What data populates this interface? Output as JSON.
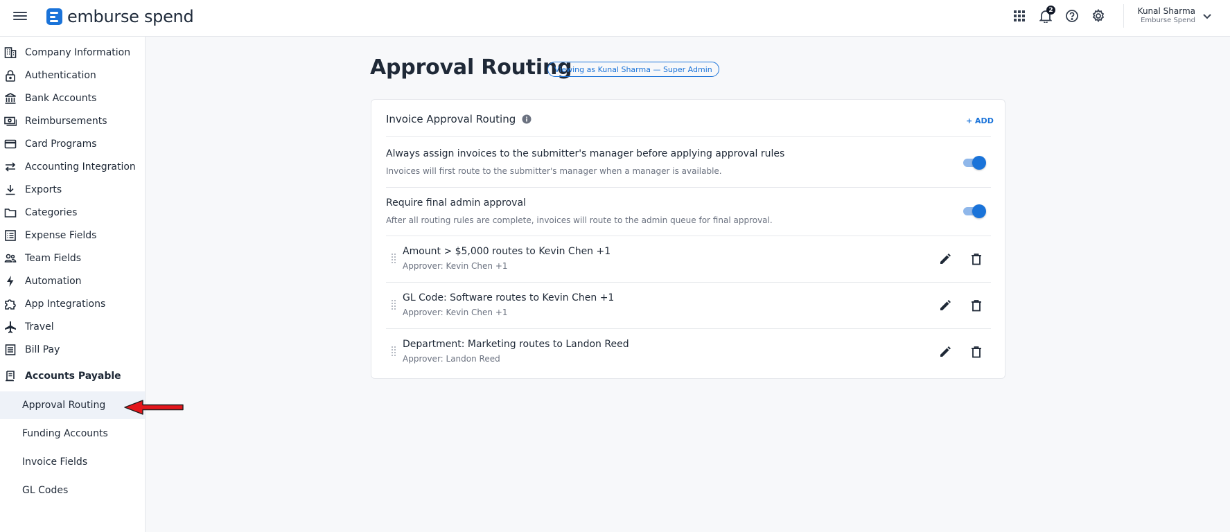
{
  "header": {
    "logo_text": "emburse spend",
    "notification_count": "2",
    "user_name": "Kunal Sharma",
    "user_org": "Emburse Spend",
    "icons": [
      "menu-icon",
      "apps-grid-icon",
      "bell-icon",
      "help-icon",
      "gear-icon",
      "chevron-down-icon"
    ]
  },
  "sidebar": {
    "items": [
      {
        "label": "Company Information",
        "icon": "building-icon"
      },
      {
        "label": "Authentication",
        "icon": "lock-icon"
      },
      {
        "label": "Bank Accounts",
        "icon": "bank-icon"
      },
      {
        "label": "Reimbursements",
        "icon": "cash-icon"
      },
      {
        "label": "Card Programs",
        "icon": "credit-card-icon"
      },
      {
        "label": "Accounting Integration",
        "icon": "swap-arrows-icon"
      },
      {
        "label": "Exports",
        "icon": "download-icon"
      },
      {
        "label": "Categories",
        "icon": "folder-icon"
      },
      {
        "label": "Expense Fields",
        "icon": "list-icon"
      },
      {
        "label": "Team Fields",
        "icon": "people-icon"
      },
      {
        "label": "Automation",
        "icon": "bolt-icon"
      },
      {
        "label": "App Integrations",
        "icon": "puzzle-icon"
      },
      {
        "label": "Travel",
        "icon": "airplane-icon"
      },
      {
        "label": "Bill Pay",
        "icon": "document-list-icon"
      }
    ],
    "section": {
      "label": "Accounts Payable",
      "icon": "receipt-icon"
    },
    "sub_items": [
      {
        "label": "Approval Routing",
        "active": true
      },
      {
        "label": "Funding Accounts",
        "active": false
      },
      {
        "label": "Invoice Fields",
        "active": false
      },
      {
        "label": "GL Codes",
        "active": false
      }
    ]
  },
  "main": {
    "title": "Approval Routing",
    "viewing_chip": "Viewing as Kunal Sharma — Super Admin",
    "card": {
      "title": "Invoice Approval Routing",
      "add_label": "+ ADD",
      "settings": [
        {
          "title": "Always assign invoices to the submitter's manager before applying approval rules",
          "description": "Invoices will first route to the submitter's manager when a manager is available.",
          "enabled": true
        },
        {
          "title": "Require final admin approval",
          "description": "After all routing rules are complete, invoices will route to the admin queue for final approval.",
          "enabled": true
        }
      ],
      "rules": [
        {
          "title": "Amount > $5,000 routes to Kevin Chen +1",
          "approver": "Approver: Kevin Chen +1"
        },
        {
          "title": "GL Code: Software routes to Kevin Chen +1",
          "approver": "Approver: Kevin Chen +1"
        },
        {
          "title": "Department: Marketing routes to Landon Reed",
          "approver": "Approver: Landon Reed"
        }
      ]
    }
  },
  "colors": {
    "accent": "#1a73d9",
    "active_bg": "#eef2f8",
    "arrow": "#e3161b"
  }
}
